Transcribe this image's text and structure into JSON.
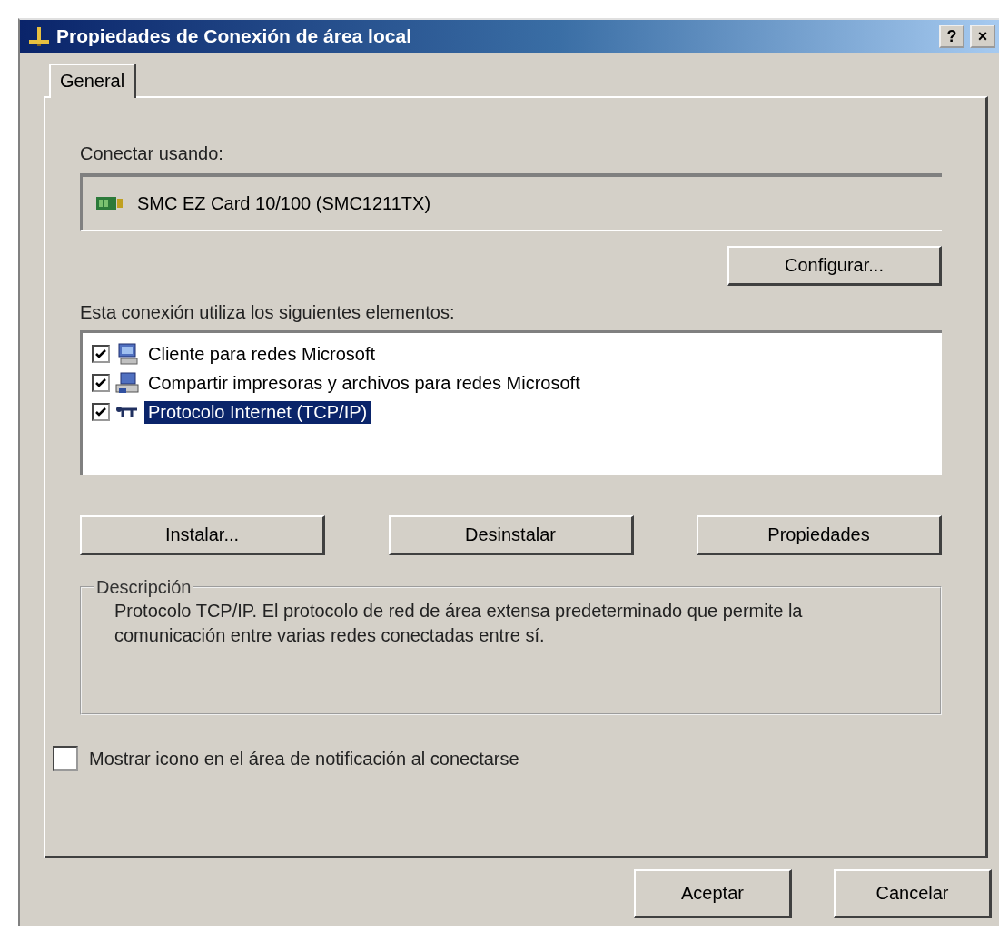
{
  "window": {
    "title": "Propiedades de Conexión de área local",
    "help": "?",
    "close": "×"
  },
  "tabs": [
    {
      "label": "General",
      "selected": true
    }
  ],
  "connect_using": {
    "label": "Conectar usando:",
    "adapter": "SMC EZ Card 10/100 (SMC1211TX)"
  },
  "configure_button": "Configurar...",
  "components": {
    "label": "Esta conexión utiliza los siguientes elementos:",
    "items": [
      {
        "kind": "client",
        "label": "Cliente para redes Microsoft",
        "checked": true,
        "selected": false
      },
      {
        "kind": "service",
        "label": "Compartir impresoras y archivos para redes Microsoft",
        "checked": true,
        "selected": false
      },
      {
        "kind": "protocol",
        "label": "Protocolo Internet (TCP/IP)",
        "checked": true,
        "selected": true
      }
    ]
  },
  "component_buttons": [
    "Instalar...",
    "Desinstalar",
    "Propiedades"
  ],
  "description": {
    "legend": "Descripción",
    "text": "Protocolo TCP/IP. El protocolo de red de área extensa predeterminado que permite la comunicación entre varias redes conectadas entre sí."
  },
  "notify_checkbox": {
    "label": "Mostrar icono en el área de notificación al conectarse",
    "checked": false
  },
  "buttons": [
    "Aceptar",
    "Cancelar"
  ]
}
